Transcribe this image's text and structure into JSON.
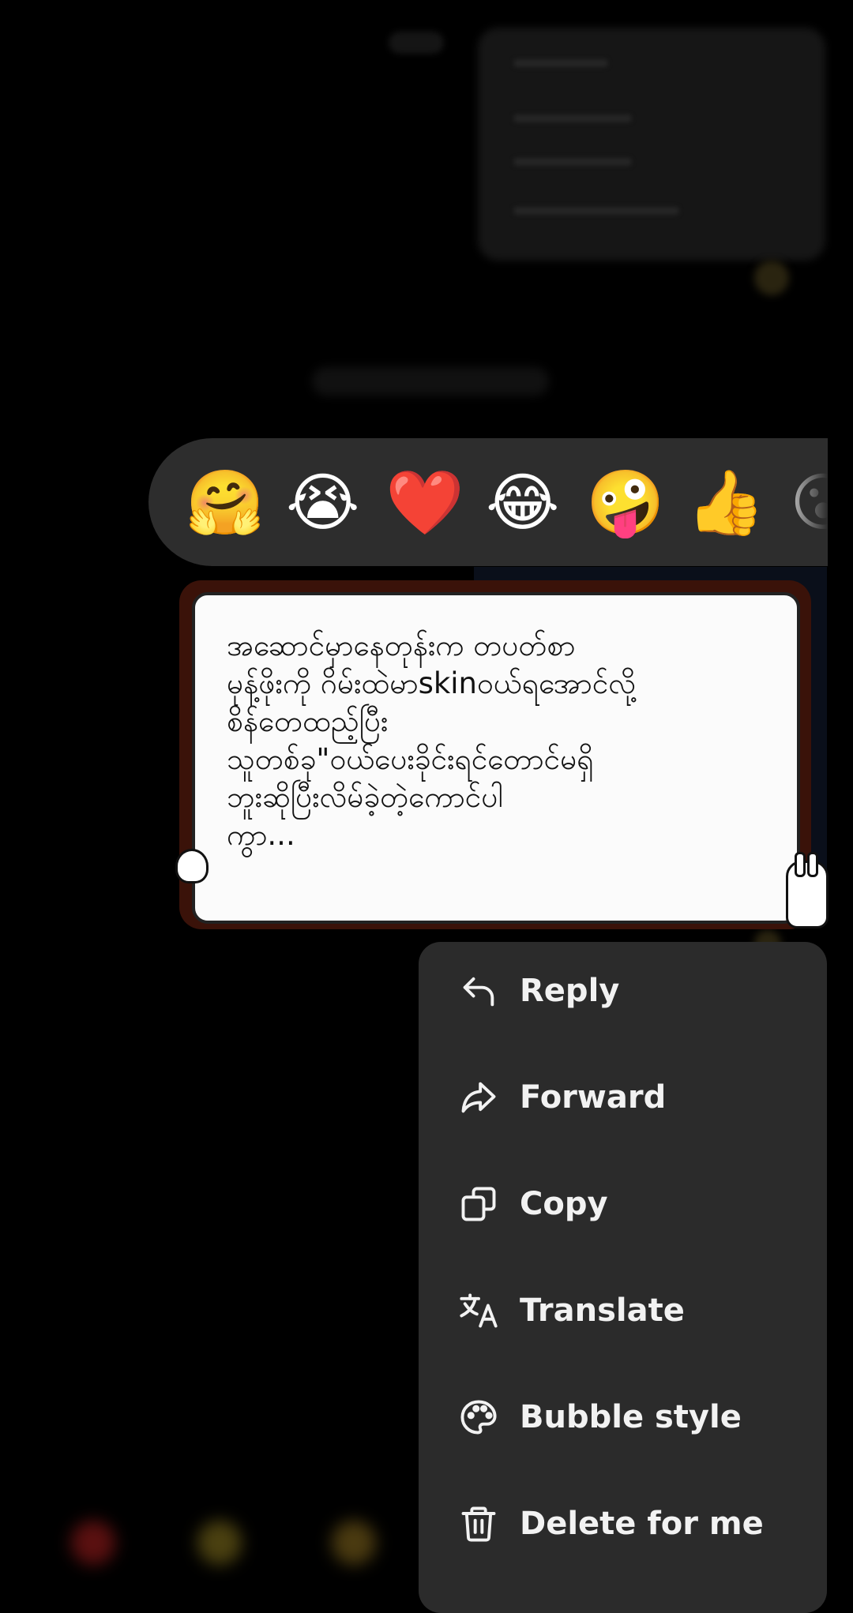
{
  "reactions": {
    "emojis": [
      "🤗",
      "😭",
      "❤️",
      "😂",
      "🤪",
      "👍",
      "😮"
    ]
  },
  "message": {
    "text": "အဆောင်မှာနေတုန်းက တပတ်စာ\nမုန့်ဖိုးကို ဂိမ်းထဲမာskinဝယ်ရအောင်လို့\nစိန်တေထည့်ပြီး\nသူတစ်ခု\"ဝယ်ပေးခိုင်းရင်တောင်မရှိ\nဘူးဆိုပြီးလိမ်ခဲ့တဲ့ကောင်ပါ\nကွာ..."
  },
  "menu": {
    "items": [
      {
        "label": "Reply",
        "icon": "reply-icon"
      },
      {
        "label": "Forward",
        "icon": "forward-icon"
      },
      {
        "label": "Copy",
        "icon": "copy-icon"
      },
      {
        "label": "Translate",
        "icon": "translate-icon"
      },
      {
        "label": "Bubble style",
        "icon": "palette-icon"
      },
      {
        "label": "Delete for me",
        "icon": "trash-icon"
      }
    ]
  }
}
